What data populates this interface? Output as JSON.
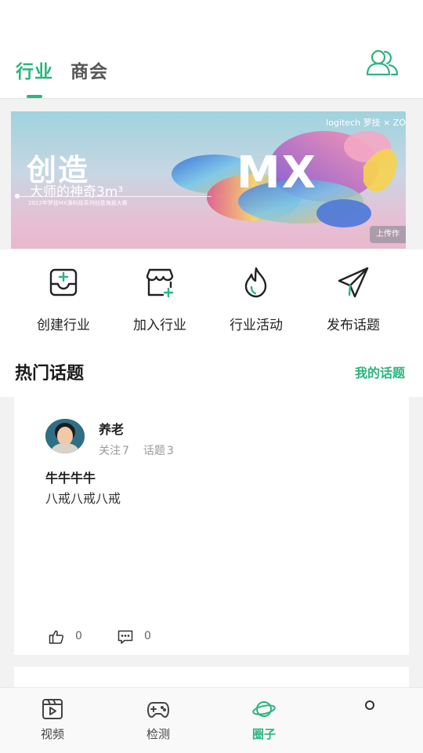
{
  "header": {
    "tabs": [
      {
        "label": "行业",
        "active": true
      },
      {
        "label": "商会",
        "active": false
      }
    ],
    "icon": "users-icon"
  },
  "banner": {
    "brand": "logitech 罗技 × ZO",
    "headline": "创造",
    "subline": "大师的神奇3m³",
    "smallprint": "2022年罗技MX滴科技系列创意海报大赛",
    "mx_text": "MX",
    "upload_label": "上传作"
  },
  "quick_actions": [
    {
      "label": "创建行业",
      "icon": "inbox-plus-icon"
    },
    {
      "label": "加入行业",
      "icon": "store-plus-icon"
    },
    {
      "label": "行业活动",
      "icon": "flame-icon"
    },
    {
      "label": "发布话题",
      "icon": "paper-plane-icon"
    }
  ],
  "hot_topics": {
    "title": "热门话题",
    "my_topics_link": "我的话题"
  },
  "post": {
    "user_name": "养老",
    "follow_label": "关注",
    "follow_count": "7",
    "topic_label": "话题",
    "topic_count": "3",
    "title": "牛牛牛牛",
    "body": "八戒八戒八戒",
    "likes": "0",
    "comments": "0"
  },
  "bottom_nav": [
    {
      "label": "视频",
      "icon": "video-icon",
      "active": false
    },
    {
      "label": "检测",
      "icon": "gamepad-icon",
      "active": false
    },
    {
      "label": "圈子",
      "icon": "planet-icon",
      "active": true
    }
  ],
  "colors": {
    "accent": "#2bb57f",
    "text": "#222222",
    "muted": "#999999"
  }
}
